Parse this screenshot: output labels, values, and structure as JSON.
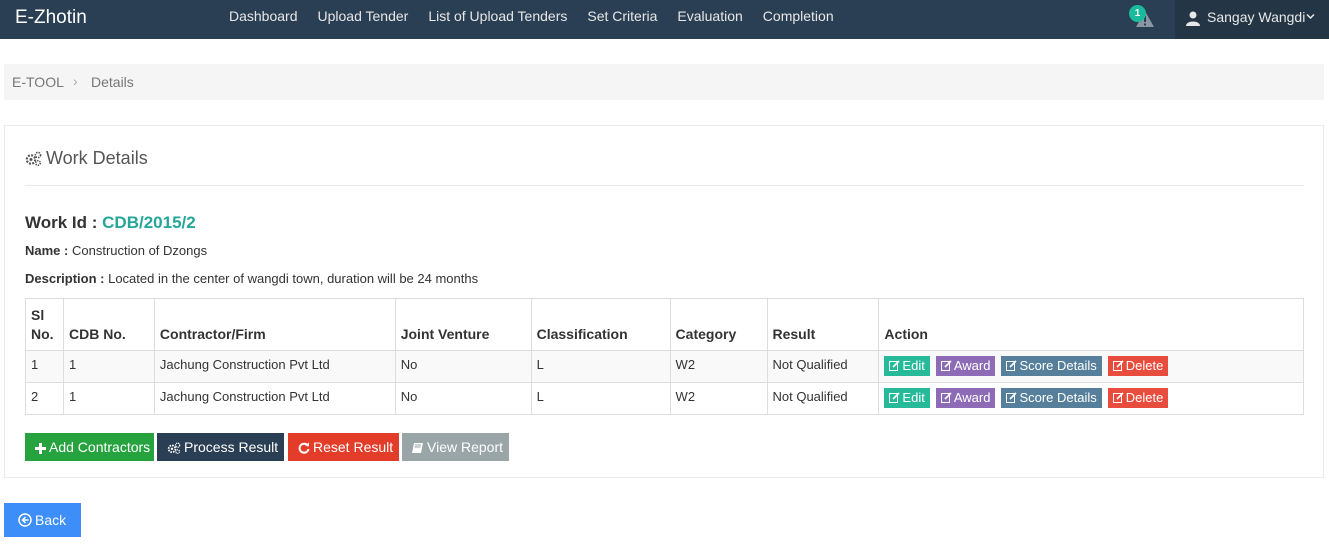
{
  "app": {
    "brand": "E-Zhotin"
  },
  "nav": {
    "items": [
      {
        "label": "Dashboard"
      },
      {
        "label": "Upload Tender"
      },
      {
        "label": "List of Upload Tenders"
      },
      {
        "label": "Set Criteria"
      },
      {
        "label": "Evaluation"
      },
      {
        "label": "Completion"
      }
    ],
    "notification_count": "1",
    "user_name": "Sangay Wangdi"
  },
  "breadcrumb": {
    "root": "E-TOOL",
    "separator": "›",
    "current": "Details"
  },
  "panel": {
    "title": "Work Details",
    "work_id_label": "Work Id :",
    "work_id": "CDB/2015/2",
    "name_label": "Name :",
    "name": "Construction of Dzongs",
    "description_label": "Description :",
    "description": "Located in the center of wangdi town, duration will be 24 months"
  },
  "table": {
    "headers": {
      "sl_line1": "Sl",
      "sl_line2": "No.",
      "cdb": "CDB No.",
      "contractor": "Contractor/Firm",
      "jv": "Joint Venture",
      "classification": "Classification",
      "category": "Category",
      "result": "Result",
      "action": "Action"
    },
    "rows": [
      {
        "sl": "1",
        "cdb": "1",
        "contractor": "Jachung Construction Pvt Ltd",
        "jv": "No",
        "classification": "L",
        "category": "W2",
        "result": "Not Qualified"
      },
      {
        "sl": "2",
        "cdb": "1",
        "contractor": "Jachung Construction Pvt Ltd",
        "jv": "No",
        "classification": "L",
        "category": "W2",
        "result": "Not Qualified"
      }
    ],
    "actions": {
      "edit": "Edit",
      "award": "Award",
      "score": "Score Details",
      "delete": "Delete"
    }
  },
  "buttons": {
    "add": "Add Contractors",
    "process": "Process Result",
    "reset": "Reset Result",
    "view": "View Report",
    "back": "Back"
  },
  "colors": {
    "navbar": "#2a3f54",
    "accent": "#26a69a",
    "edit": "#26b99a",
    "award": "#8e6bb6",
    "score": "#567f9c",
    "delete": "#e74c3c",
    "add": "#26a33f",
    "reset": "#e33d2a",
    "view": "#9aa5a8",
    "back": "#3d8ef8"
  },
  "icons": {
    "notification": "warning-icon",
    "user": "user-icon",
    "panel": "gears-icon",
    "edit": "edit-icon",
    "add": "plus-icon",
    "process": "gears-icon",
    "reset": "refresh-icon",
    "view": "book-icon",
    "back": "arrow-circle-left-icon"
  }
}
